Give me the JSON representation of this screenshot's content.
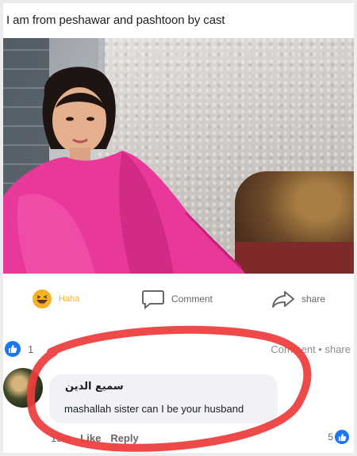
{
  "post": {
    "text": "I am from peshawar and pashtoon by cast"
  },
  "actions": {
    "haha_label": "Haha",
    "comment_label": "Comment",
    "share_label": "share"
  },
  "reactions": {
    "count": "1",
    "right_text": "Comment • share"
  },
  "comment": {
    "author": "سمیع الدین",
    "text": "mashallah sister can I be your husband",
    "time": "15m",
    "like_label": "Like",
    "reply_label": "Reply",
    "reaction_count": "5"
  },
  "colors": {
    "accent": "#1877f2",
    "haha": "#f7b125",
    "annotation": "#ee3b3b",
    "scarf": "#e8399a"
  },
  "icons": [
    "haha-emoji-icon",
    "comment-icon",
    "share-icon",
    "like-icon"
  ]
}
